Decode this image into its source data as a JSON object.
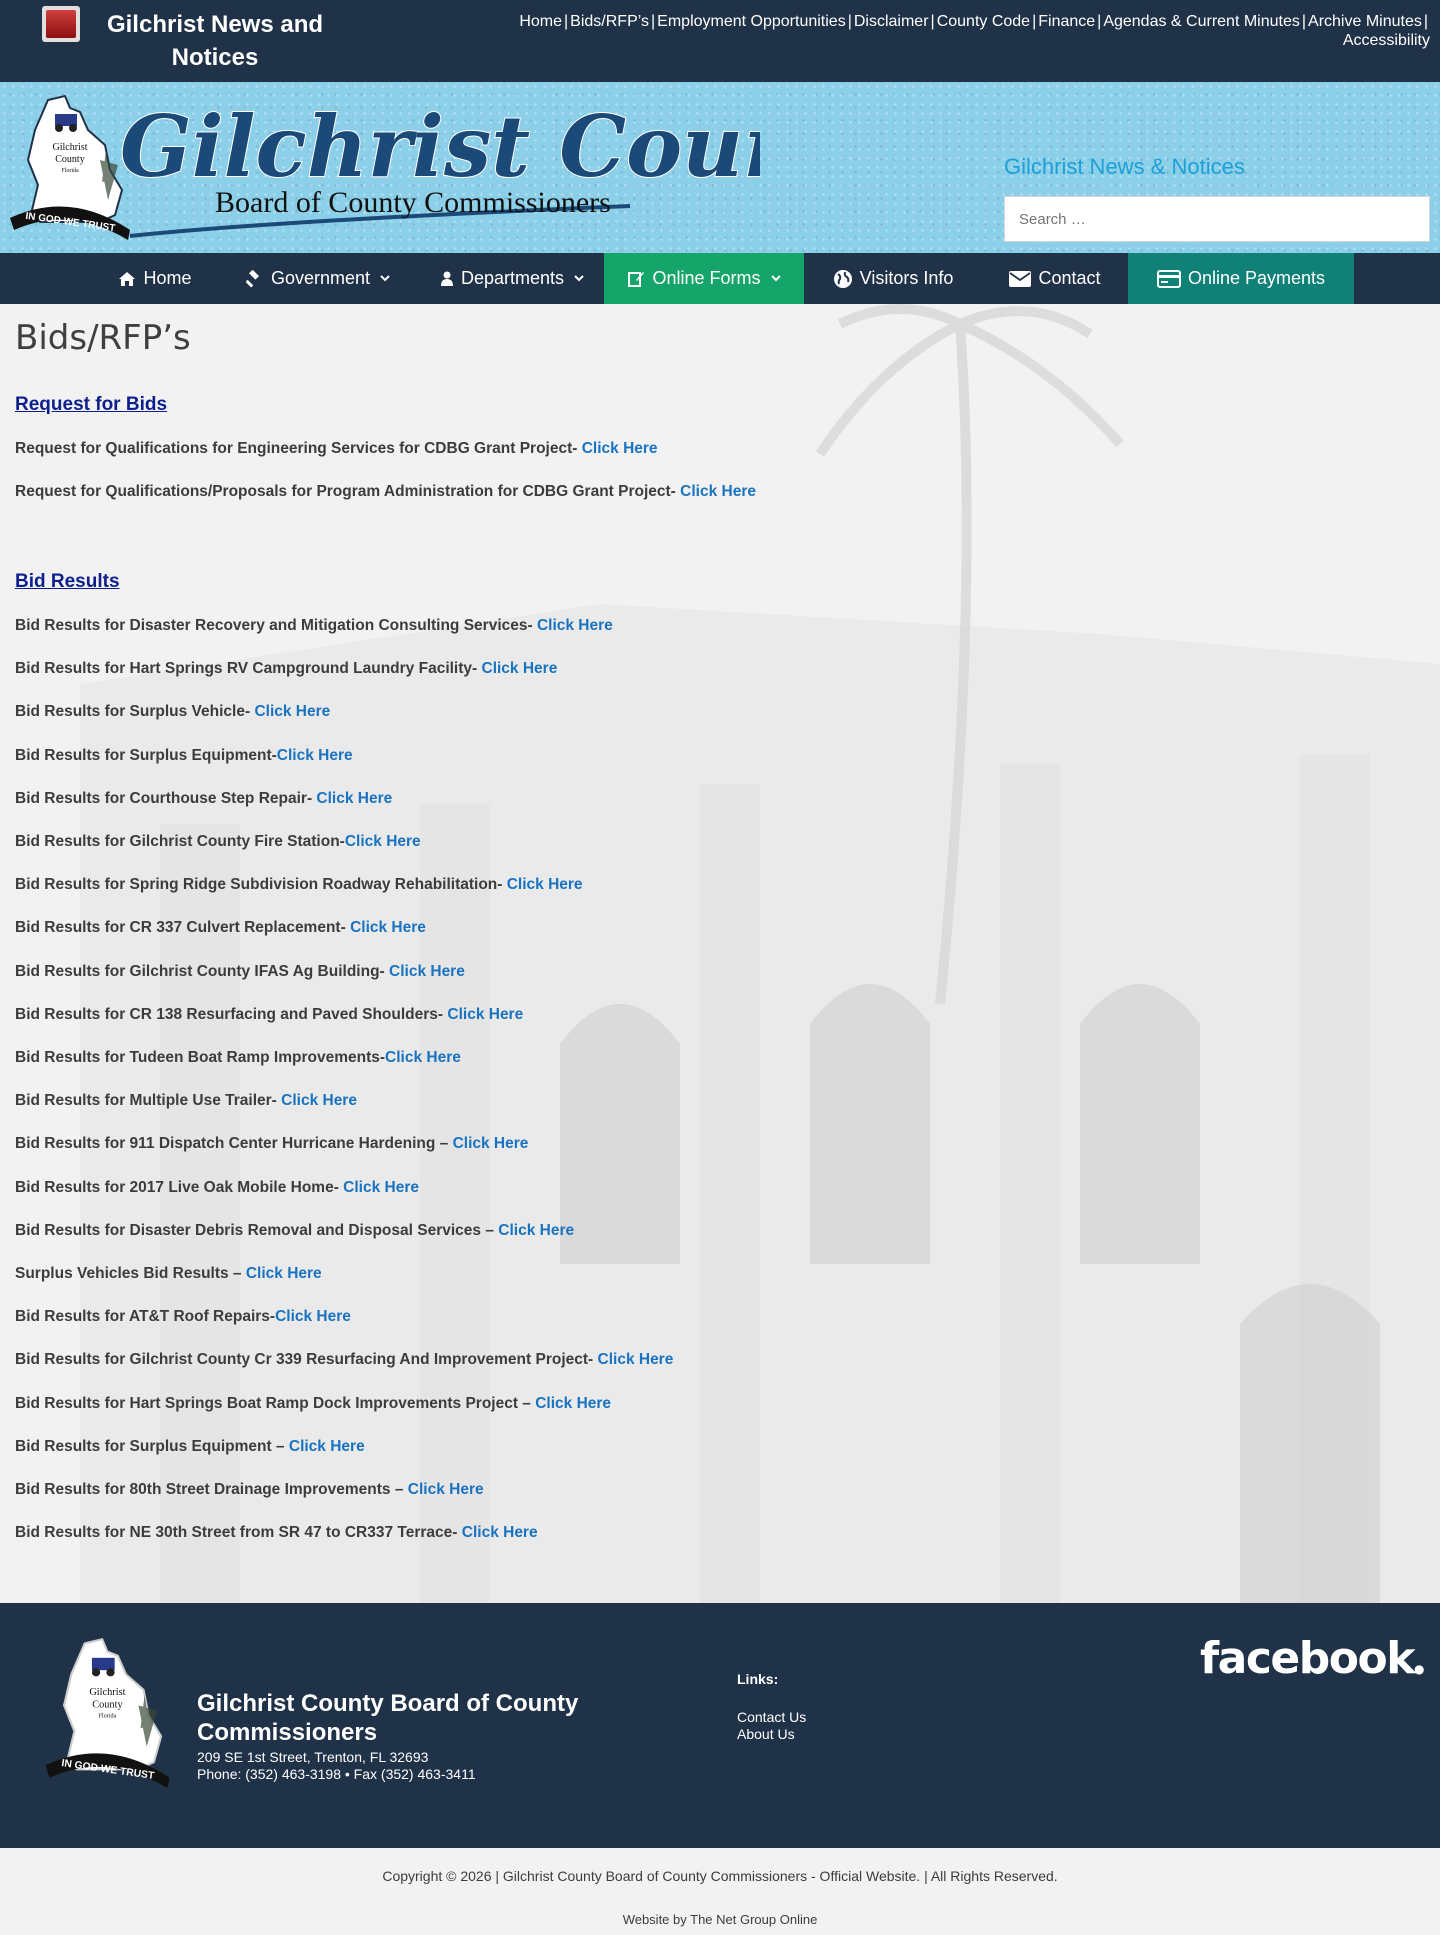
{
  "alert": {
    "title": "Gilchrist News and Notices"
  },
  "top_links": [
    "Home",
    "Bids/RFP’s",
    "Employment Opportunities",
    "Disclaimer",
    "County Code",
    "Finance",
    "Agendas & Current Minutes",
    "Archive Minutes",
    "Accessibility"
  ],
  "top_link_separator": "|",
  "header": {
    "logo_title": "Gilchrist County",
    "logo_subtitle": "Board of County Commissioners",
    "seal_text": [
      "Gilchrist",
      "County",
      "Florida",
      "IN GOD WE TRUST"
    ],
    "news_title": "Gilchrist News & Notices",
    "search_placeholder": "Search …"
  },
  "nav": [
    {
      "label": "Home",
      "icon": "home-icon",
      "dropdown": false
    },
    {
      "label": "Government",
      "icon": "gavel-icon",
      "dropdown": true
    },
    {
      "label": "Departments",
      "icon": "person-icon",
      "dropdown": true
    },
    {
      "label": "Online Forms",
      "icon": "edit-form-icon",
      "dropdown": true,
      "highlight": "#15a56a"
    },
    {
      "label": "Visitors Info",
      "icon": "globe-icon",
      "dropdown": false
    },
    {
      "label": "Contact",
      "icon": "envelope-icon",
      "dropdown": false
    },
    {
      "label": "Online Payments",
      "icon": "credit-card-icon",
      "dropdown": false,
      "highlight": "#0f8177"
    }
  ],
  "page": {
    "title": "Bids/RFP’s",
    "link_text": "Click Here",
    "request_heading": "Request for Bids",
    "requests": [
      {
        "text": "Request for Qualifications for Engineering Services for CDBG Grant Project- "
      },
      {
        "text": "Request for Qualifications/Proposals  for Program Administration for CDBG Grant Project- "
      }
    ],
    "results_heading": "Bid Results",
    "results": [
      {
        "text": "Bid Results for Disaster Recovery and Mitigation Consulting Services- "
      },
      {
        "text": "Bid Results for Hart Springs RV Campground Laundry Facility- "
      },
      {
        "text": "Bid Results for Surplus Vehicle- "
      },
      {
        "text": "Bid Results for Surplus Equipment-"
      },
      {
        "text": "Bid Results for Courthouse Step Repair- "
      },
      {
        "text": "Bid Results for Gilchrist County Fire Station-"
      },
      {
        "text": "Bid Results for Spring Ridge Subdivision Roadway Rehabilitation- "
      },
      {
        "text": "Bid Results for CR 337 Culvert Replacement- "
      },
      {
        "text": "Bid Results for Gilchrist County IFAS Ag Building- "
      },
      {
        "text": "Bid Results for CR 138 Resurfacing and Paved Shoulders- "
      },
      {
        "text": "Bid Results for Tudeen Boat Ramp Improvements-"
      },
      {
        "text": "Bid Results for Multiple Use Trailer- "
      },
      {
        "text": "Bid Results for 911 Dispatch Center Hurricane Hardening – "
      },
      {
        "text": "Bid Results for 2017 Live Oak Mobile Home- "
      },
      {
        "text": "Bid Results for Disaster Debris Removal and Disposal Services – "
      },
      {
        "text": "Surplus Vehicles Bid Results – "
      },
      {
        "text": "Bid Results for AT&T Roof Repairs-"
      },
      {
        "text": "Bid Results for Gilchrist County Cr 339 Resurfacing And Improvement Project- "
      },
      {
        "text": "Bid Results for Hart Springs Boat Ramp Dock Improvements Project – "
      },
      {
        "text": "Bid Results for Surplus Equipment – "
      },
      {
        "text": "Bid Results for 80th Street Drainage Improvements – "
      },
      {
        "text": "Bid Results for NE 30th Street from SR 47 to CR337 Terrace- "
      }
    ]
  },
  "footer": {
    "title": "Gilchrist County Board of County Commissioners",
    "address": "209 SE 1st Street, Trenton, FL 32693",
    "phone": "Phone: (352) 463-3198 • Fax (352) 463-3411",
    "links_heading": "Links:",
    "links": [
      "Contact Us",
      "About Us"
    ],
    "facebook": "facebook",
    "copyright": "Copyright © 2026 | Gilchrist County Board of County Commissioners - Official Website. | All Rights Reserved.",
    "credit": "Website by The Net Group Online"
  },
  "colors": {
    "top_bar": "#1f3248",
    "banner": "#8ccfe8",
    "nav_highlight_green": "#15a56a",
    "nav_highlight_teal": "#0f8177",
    "link": "#1a73c0",
    "section_heading": "#0d1f8c"
  }
}
